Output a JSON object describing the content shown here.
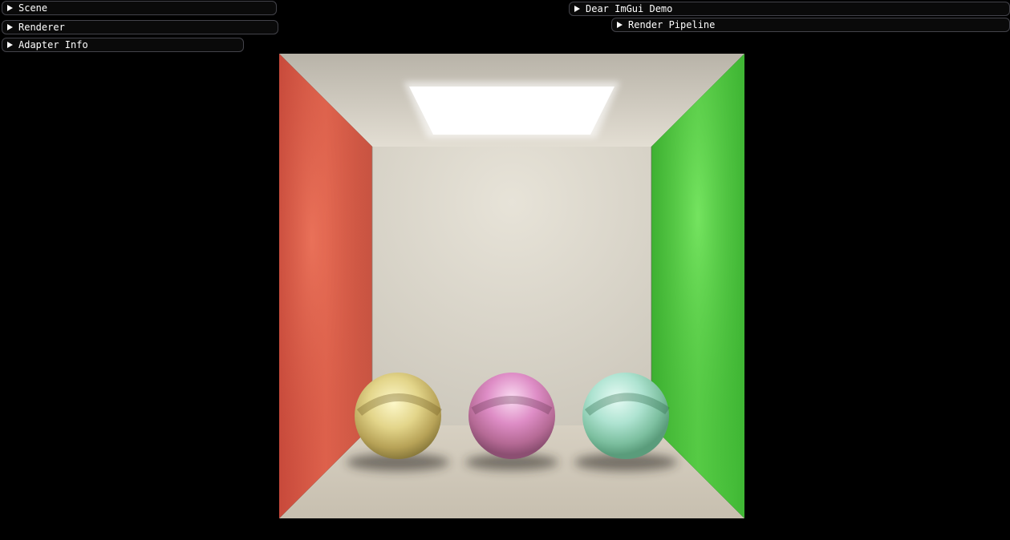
{
  "windows": {
    "scene": {
      "label": "Scene"
    },
    "renderer": {
      "label": "Renderer"
    },
    "adapter_info": {
      "label": "Adapter Info"
    },
    "demo": {
      "label": "Dear ImGui Demo"
    },
    "render_pipeline": {
      "label": "Render Pipeline"
    }
  },
  "icons": {
    "collapse_arrow": "triangle-right-icon"
  },
  "viewport": {
    "description_colors": {
      "background": "#000000",
      "left_wall": "#e0604e",
      "right_wall": "#4cc83f",
      "back_wall": "#ddd9cf",
      "floor": "#d2cbbd",
      "light": "#ffffff"
    },
    "spheres": [
      {
        "name": "yellow-sphere",
        "color": "#e8dc8c"
      },
      {
        "name": "pink-sphere",
        "color": "#e58bc5"
      },
      {
        "name": "teal-sphere",
        "color": "#a8e0cf"
      }
    ]
  }
}
